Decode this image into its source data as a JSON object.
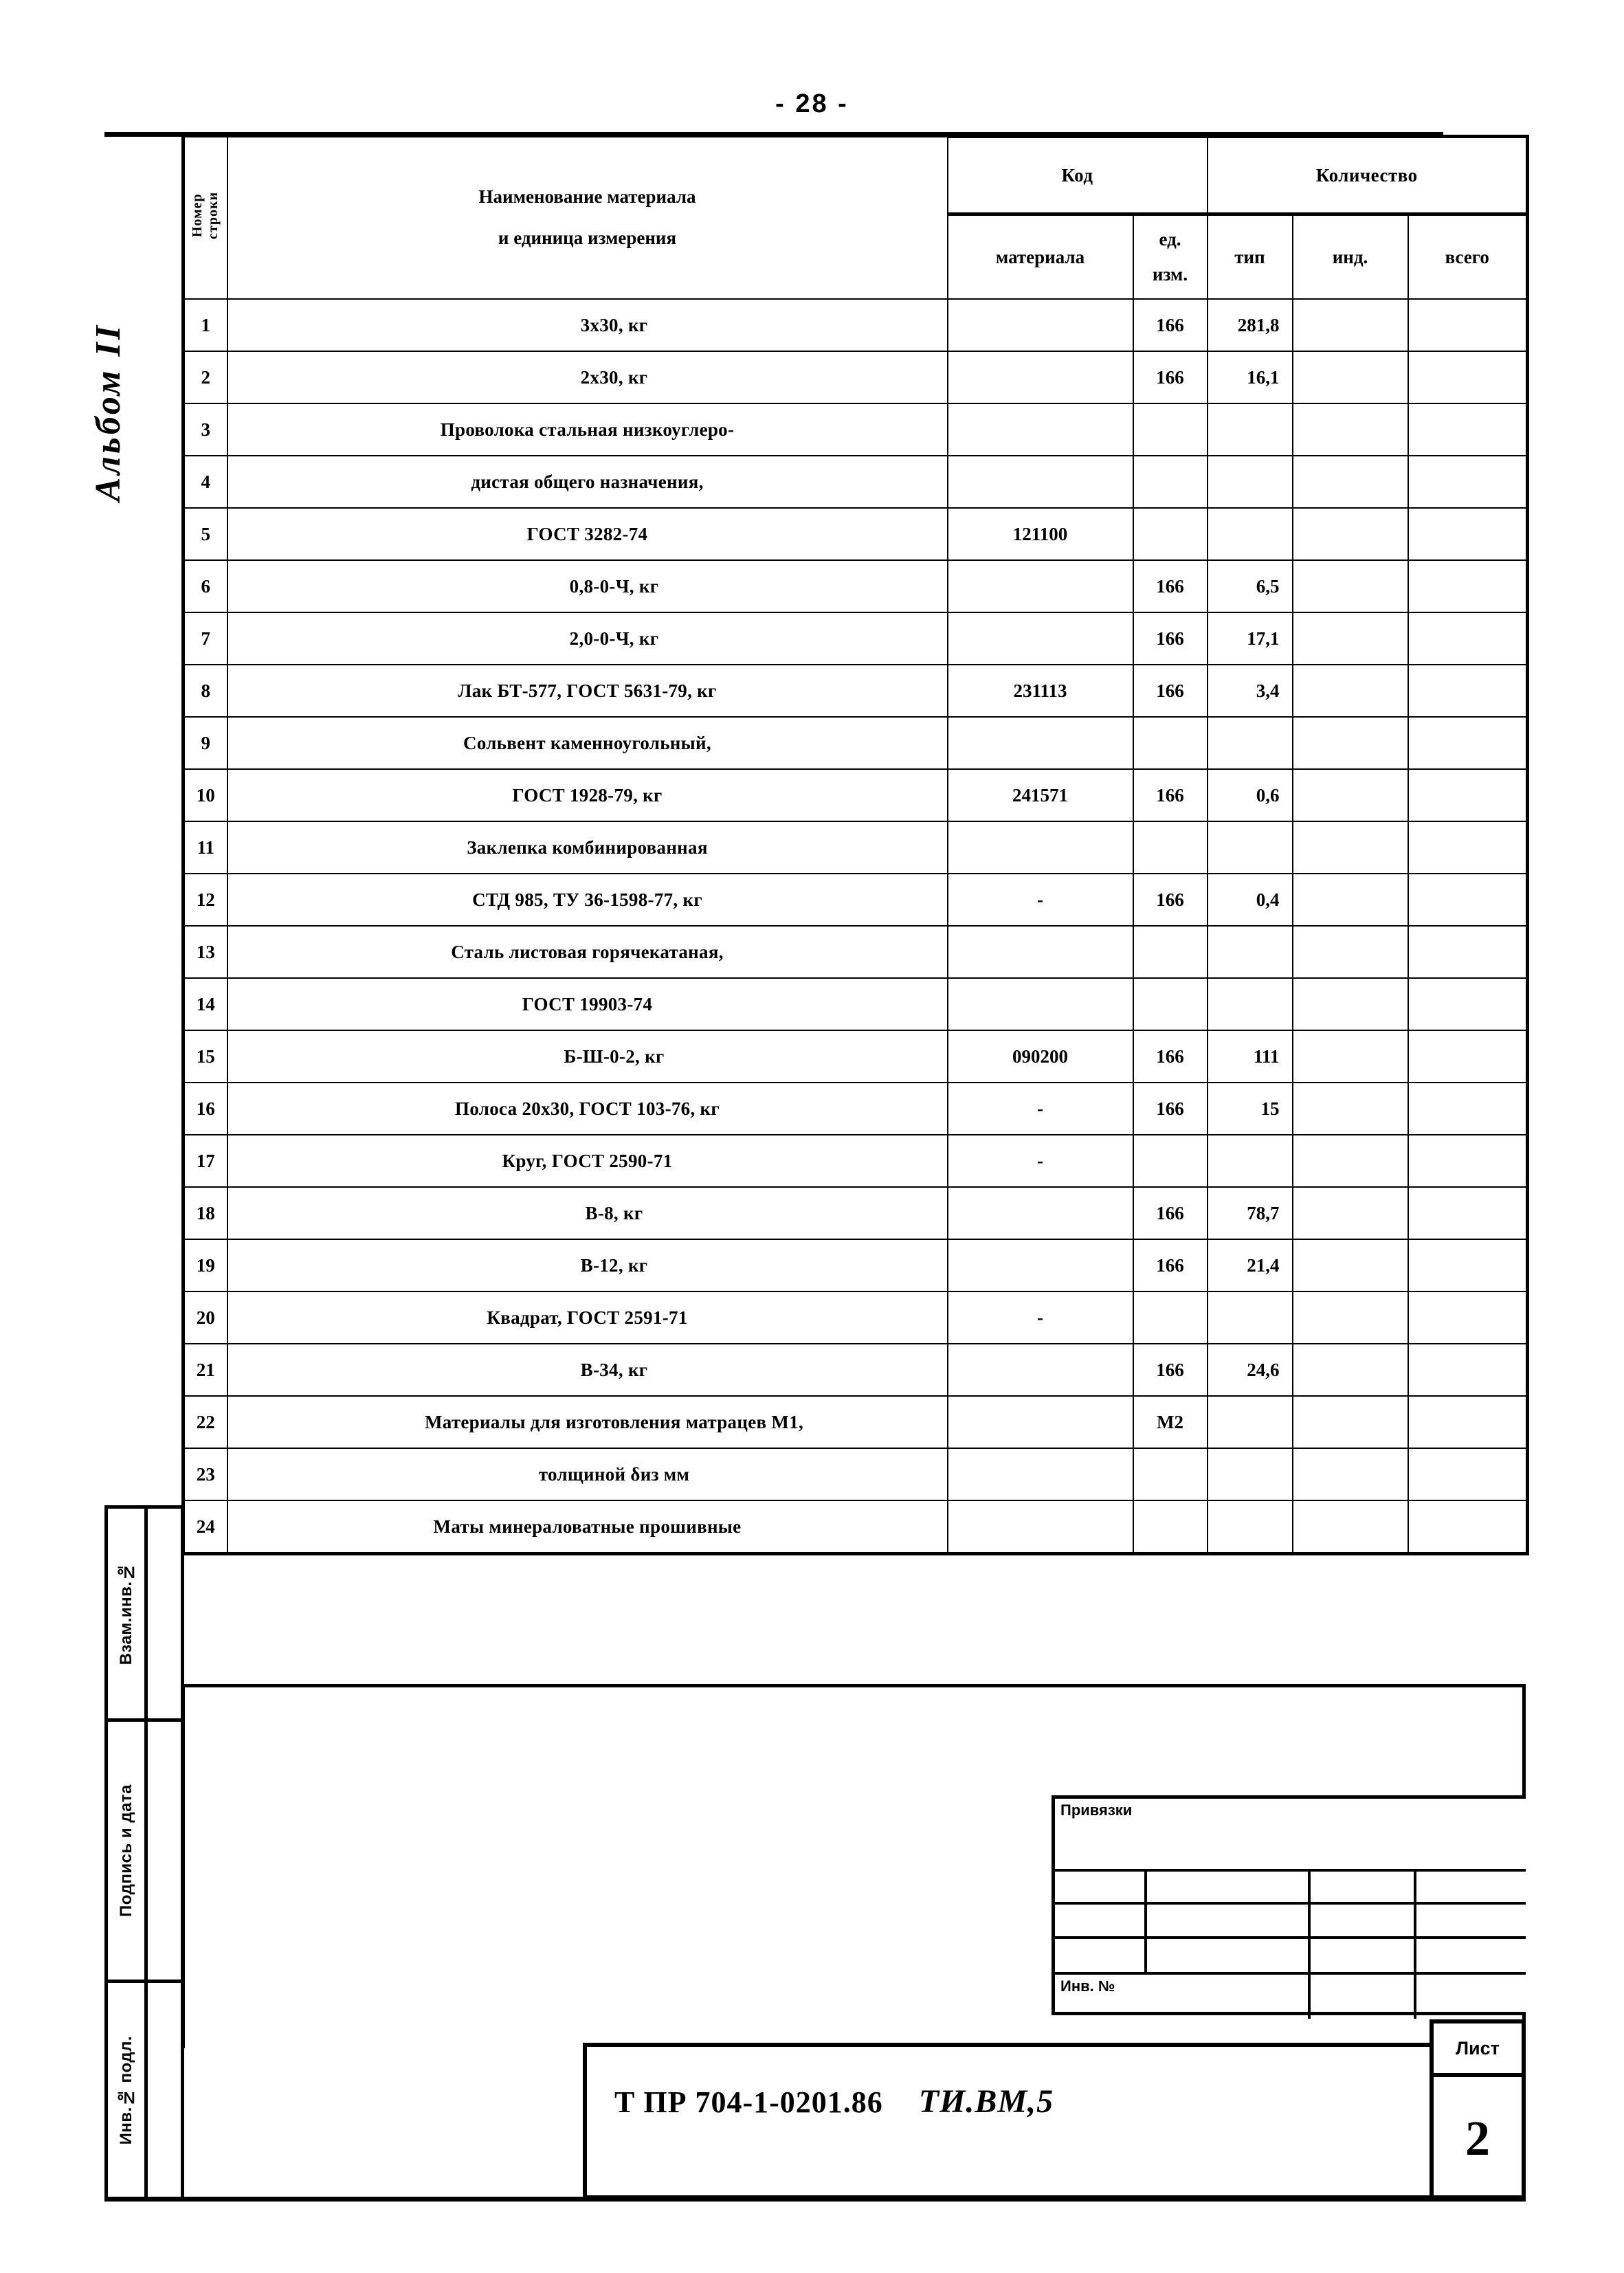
{
  "page": {
    "number_label": "- 28 -",
    "album_note": "Альбом II"
  },
  "table": {
    "headers": {
      "row_number": "Номер\nстроки",
      "material_name": "Наименование материала",
      "material_unit": "и единица измерения",
      "code": "Код",
      "quantity": "Количество",
      "code_material": "материала",
      "code_unit": "ед.\nизм.",
      "qty_type": "тип",
      "qty_ind": "инд.",
      "qty_total": "всего"
    },
    "rows": [
      {
        "no": "1",
        "name": "3х30, кг",
        "indent": 1,
        "code": "",
        "unit": "166",
        "type": "281,8",
        "ind": "",
        "total": ""
      },
      {
        "no": "2",
        "name": "2х30, кг",
        "indent": 1,
        "code": "",
        "unit": "166",
        "type": "16,1",
        "ind": "",
        "total": ""
      },
      {
        "no": "3",
        "name": "Проволока стальная низкоуглеро-",
        "indent": 0,
        "code": "",
        "unit": "",
        "type": "",
        "ind": "",
        "total": ""
      },
      {
        "no": "4",
        "name": "дистая общего назначения,",
        "indent": 0,
        "code": "",
        "unit": "",
        "type": "",
        "ind": "",
        "total": ""
      },
      {
        "no": "5",
        "name": "ГОСТ 3282-74",
        "indent": 0,
        "code": "121100",
        "unit": "",
        "type": "",
        "ind": "",
        "total": ""
      },
      {
        "no": "6",
        "name": "0,8-0-Ч, кг",
        "indent": 1,
        "code": "",
        "unit": "166",
        "type": "6,5",
        "ind": "",
        "total": ""
      },
      {
        "no": "7",
        "name": "2,0-0-Ч, кг",
        "indent": 1,
        "code": "",
        "unit": "166",
        "type": "17,1",
        "ind": "",
        "total": ""
      },
      {
        "no": "8",
        "name": "Лак БТ-577, ГОСТ 5631-79, кг",
        "indent": 0,
        "code": "231113",
        "unit": "166",
        "type": "3,4",
        "ind": "",
        "total": ""
      },
      {
        "no": "9",
        "name": "Сольвент каменноугольный,",
        "indent": 0,
        "code": "",
        "unit": "",
        "type": "",
        "ind": "",
        "total": ""
      },
      {
        "no": "10",
        "name": "ГОСТ 1928-79, кг",
        "indent": 0,
        "code": "241571",
        "unit": "166",
        "type": "0,6",
        "ind": "",
        "total": ""
      },
      {
        "no": "11",
        "name": "Заклепка комбинированная",
        "indent": 0,
        "code": "",
        "unit": "",
        "type": "",
        "ind": "",
        "total": ""
      },
      {
        "no": "12",
        "name": "СТД 985, ТУ 36-1598-77, кг",
        "indent": 0,
        "code": "-",
        "unit": "166",
        "type": "0,4",
        "ind": "",
        "total": ""
      },
      {
        "no": "13",
        "name": "Сталь листовая горячекатаная,",
        "indent": 0,
        "code": "",
        "unit": "",
        "type": "",
        "ind": "",
        "total": ""
      },
      {
        "no": "14",
        "name": "ГОСТ 19903-74",
        "indent": 0,
        "code": "",
        "unit": "",
        "type": "",
        "ind": "",
        "total": ""
      },
      {
        "no": "15",
        "name": "Б-Ш-0-2, кг",
        "indent": 1,
        "code": "090200",
        "unit": "166",
        "type": "111",
        "ind": "",
        "total": ""
      },
      {
        "no": "16",
        "name": "Полоса 20х30, ГОСТ 103-76, кг",
        "indent": 0,
        "code": "-",
        "unit": "166",
        "type": "15",
        "ind": "",
        "total": ""
      },
      {
        "no": "17",
        "name": "Круг, ГОСТ 2590-71",
        "indent": 0,
        "code": "-",
        "unit": "",
        "type": "",
        "ind": "",
        "total": ""
      },
      {
        "no": "18",
        "name": "В-8, кг",
        "indent": 1,
        "code": "",
        "unit": "166",
        "type": "78,7",
        "ind": "",
        "total": ""
      },
      {
        "no": "19",
        "name": "В-12, кг",
        "indent": 1,
        "code": "",
        "unit": "166",
        "type": "21,4",
        "ind": "",
        "total": ""
      },
      {
        "no": "20",
        "name": "Квадрат, ГОСТ 2591-71",
        "indent": 0,
        "code": "-",
        "unit": "",
        "type": "",
        "ind": "",
        "total": ""
      },
      {
        "no": "21",
        "name": "В-34, кг",
        "indent": 1,
        "code": "",
        "unit": "166",
        "type": "24,6",
        "ind": "",
        "total": ""
      },
      {
        "no": "22",
        "name": "Материалы для изготовления матрацев М1,",
        "indent": 1,
        "code": "",
        "unit": "М2",
        "type": "",
        "ind": "",
        "total": ""
      },
      {
        "no": "23",
        "name": "толщиной δиз  мм",
        "indent": 1,
        "code": "",
        "unit": "",
        "type": "",
        "ind": "",
        "total": ""
      },
      {
        "no": "24",
        "name": "Маты минераловатные прошивные",
        "indent": 0,
        "code": "",
        "unit": "",
        "type": "",
        "ind": "",
        "total": ""
      }
    ]
  },
  "side_stamp": {
    "labels": [
      "Взам.инв.№",
      "Подпись и дата",
      "Инв.№ подл."
    ]
  },
  "binding_stamp": {
    "title": "Привязки",
    "inv_label": "Инв. №"
  },
  "title_block": {
    "document_code": "Т ПР 704-1-0201.86",
    "document_mark": "ТИ.ВМ,5",
    "sheet_label": "Лист",
    "sheet_number": "2"
  }
}
